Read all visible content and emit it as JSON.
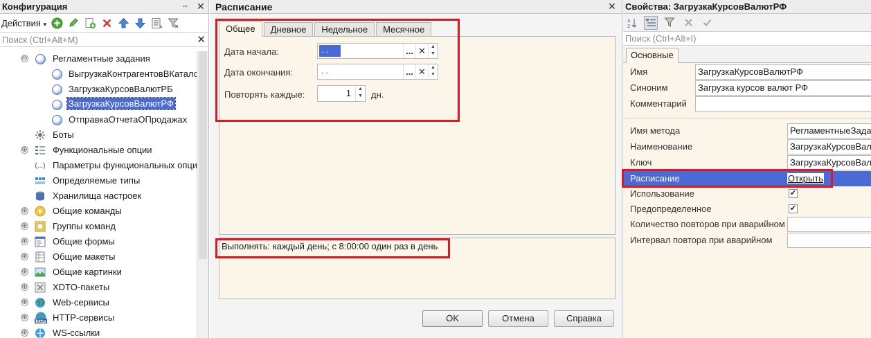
{
  "config_panel": {
    "title": "Конфигурация",
    "pin_glyph": "⇔",
    "close_glyph": "✕",
    "actions_label": "Действия",
    "actions_caret": "▾",
    "search_placeholder": "Поиск (Ctrl+Alt+M)",
    "search_clear": "✕",
    "toolbar_icons": {
      "add": "plus-circle-icon",
      "edit": "pencil-icon",
      "copy": "copy-add-icon",
      "delete": "delete-icon",
      "move_up": "arrow-up-icon",
      "move_down": "arrow-down-icon",
      "list": "list-icon",
      "filter": "filter-icon"
    },
    "tree": [
      {
        "label": "Регламентные задания",
        "expander": "⊖",
        "icon": "clock-group-icon",
        "level": 0
      },
      {
        "label": "ВыгрузкаКонтрагентовВКаталог",
        "icon": "clock-icon",
        "level": 1
      },
      {
        "label": "ЗагрузкаКурсовВалютРБ",
        "icon": "clock-icon",
        "level": 1
      },
      {
        "label": "ЗагрузкаКурсовВалютРФ",
        "icon": "clock-icon",
        "level": 1,
        "selected": true
      },
      {
        "label": "ОтправкаОтчетаОПродажах",
        "icon": "clock-icon",
        "level": 1
      },
      {
        "label": "Боты",
        "icon": "bot-icon",
        "level": 0
      },
      {
        "label": "Функциональные опции",
        "expander": "⊕",
        "icon": "options-icon",
        "level": 0
      },
      {
        "label": "Параметры функциональных опций",
        "icon": "params-icon",
        "level": 0
      },
      {
        "label": "Определяемые типы",
        "icon": "types-icon",
        "level": 0
      },
      {
        "label": "Хранилища настроек",
        "icon": "storage-icon",
        "level": 0
      },
      {
        "label": "Общие команды",
        "expander": "⊕",
        "icon": "command-icon",
        "level": 0
      },
      {
        "label": "Группы команд",
        "expander": "⊕",
        "icon": "command-group-icon",
        "level": 0
      },
      {
        "label": "Общие формы",
        "expander": "⊕",
        "icon": "form-icon",
        "level": 0
      },
      {
        "label": "Общие макеты",
        "expander": "⊕",
        "icon": "layout-icon",
        "level": 0
      },
      {
        "label": "Общие картинки",
        "expander": "⊕",
        "icon": "picture-icon",
        "level": 0
      },
      {
        "label": "XDTO-пакеты",
        "expander": "⊕",
        "icon": "xdto-icon",
        "level": 0
      },
      {
        "label": "Web-сервисы",
        "expander": "⊕",
        "icon": "globe-icon",
        "level": 0
      },
      {
        "label": "HTTP-сервисы",
        "expander": "⊕",
        "icon": "http-icon",
        "level": 0,
        "icon_text": "http"
      },
      {
        "label": "WS-ссылки",
        "expander": "⊕",
        "icon": "ws-icon",
        "level": 0
      }
    ]
  },
  "schedule_dialog": {
    "title": "Расписание",
    "close_glyph": "✕",
    "tabs": [
      "Общее",
      "Дневное",
      "Недельное",
      "Месячное"
    ],
    "active_tab": "Общее",
    "start_date_label": "Дата начала:",
    "start_date_value": " .  .",
    "end_date_label": "Дата окончания:",
    "end_date_value": " .  .",
    "repeat_label": "Повторять каждые:",
    "repeat_value": "1",
    "repeat_unit": "дн.",
    "select_glyph": "...",
    "clear_glyph": "✕",
    "spin_up": "▲",
    "spin_down": "▼",
    "summary": "Выполнять: каждый день; с 8:00:00 один раз в день",
    "buttons": {
      "ok": "OK",
      "cancel": "Отмена",
      "help": "Справка"
    }
  },
  "props_panel": {
    "title": "Свойства: ЗагрузкаКурсовВалютРФ",
    "search_placeholder": "Поиск (Ctrl+Alt+I)",
    "toolbar_icons": [
      "sort-az-icon",
      "categories-icon",
      "filter-icon",
      "clear-icon",
      "check-icon"
    ],
    "tab": "Основные",
    "properties": {
      "name_label": "Имя",
      "name_value": "ЗагрузкаКурсовВалютРФ",
      "synonym_label": "Синоним",
      "synonym_value": "Загрузка курсов валют РФ",
      "comment_label": "Комментарий",
      "comment_value": "",
      "method_label": "Имя метода",
      "method_value": "РегламентныеЗадания",
      "description_label": "Наименование",
      "description_value": "ЗагрузкаКурсовВалют",
      "key_label": "Ключ",
      "key_value": "ЗагрузкаКурсовВалют",
      "schedule_label": "Расписание",
      "schedule_link": "Открыть",
      "use_label": "Использование",
      "use_checked": "✔",
      "predefined_label": "Предопределенное",
      "predefined_checked": "✔",
      "retry_count_label": "Количество повторов при аварийном",
      "retry_count_value": "",
      "retry_interval_label": "Интервал повтора при аварийном",
      "retry_interval_value": ""
    }
  },
  "colors": {
    "selection": "#4a6ad8",
    "annotation": "#e3161c",
    "form_background": "#fbf6e9"
  }
}
